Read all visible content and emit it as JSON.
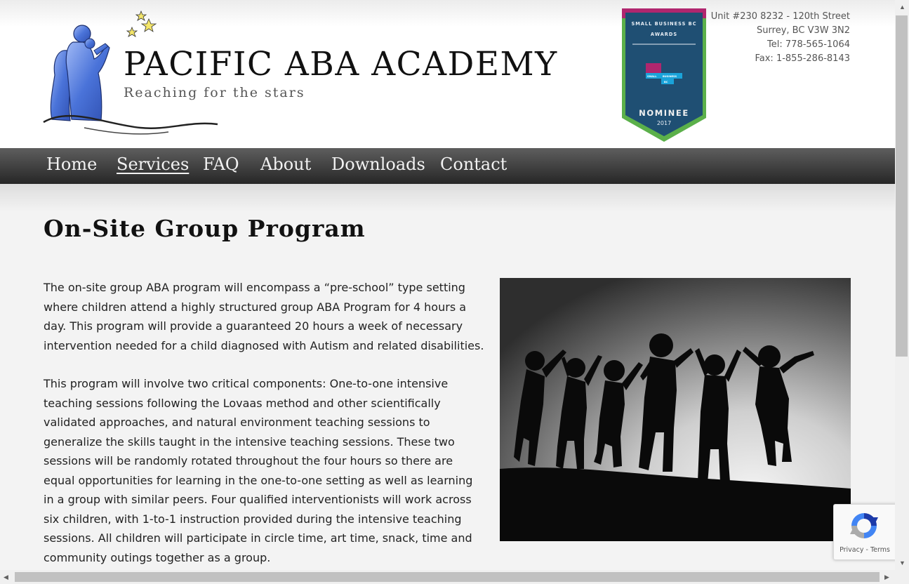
{
  "site": {
    "title": "PACIFIC ABA ACADEMY",
    "tagline": "Reaching for the stars"
  },
  "award": {
    "line1": "SMALL BUSINESS BC",
    "line2": "AWARDS",
    "logo_text1": "SMALL",
    "logo_text2": "BUSINESS",
    "logo_text3": "BC",
    "status": "NOMINEE",
    "year": "2017"
  },
  "contact": {
    "address1": "Unit #230 8232 - 120th Street",
    "address2": "Surrey, BC V3W 3N2",
    "tel": "Tel: 778-565-1064",
    "fax": "Fax: 1-855-286-8143"
  },
  "nav": {
    "items": [
      {
        "label": "Home"
      },
      {
        "label": "Services",
        "active": true
      },
      {
        "label": "FAQ"
      },
      {
        "label": "About"
      },
      {
        "label": "Downloads"
      },
      {
        "label": "Contact"
      }
    ]
  },
  "content": {
    "title": "On-Site Group Program",
    "paragraphs": [
      "The on-site group ABA program will encompass a “pre-school” type setting where children attend a highly structured group ABA Program for 4 hours a day. This program will provide a guaranteed 20 hours a week of necessary intervention needed for a child diagnosed with Autism and related disabilities.",
      "This program will involve two critical components: One-to-one intensive teaching sessions following the Lovaas method and other scientifically validated approaches, and natural environment teaching sessions to generalize the skills taught in the intensive teaching sessions. These two sessions will be randomly rotated throughout the four hours so there are equal opportunities for learning in the one-to-one setting as well as learning in a group with similar peers. Four qualified interventionists will work across six children, with 1-to-1 instruction provided during the intensive teaching sessions. All children will participate in circle time, art time, snack, time and community outings together as a group."
    ]
  },
  "recaptcha": {
    "links": "Privacy - Terms"
  },
  "colors": {
    "nav_top": "#5e5e5e",
    "nav_bottom": "#262626",
    "badge_pink": "#b0266e",
    "badge_blue": "#1f4f73",
    "badge_green": "#5bb04a",
    "logo_blue": "#4a73d9"
  }
}
